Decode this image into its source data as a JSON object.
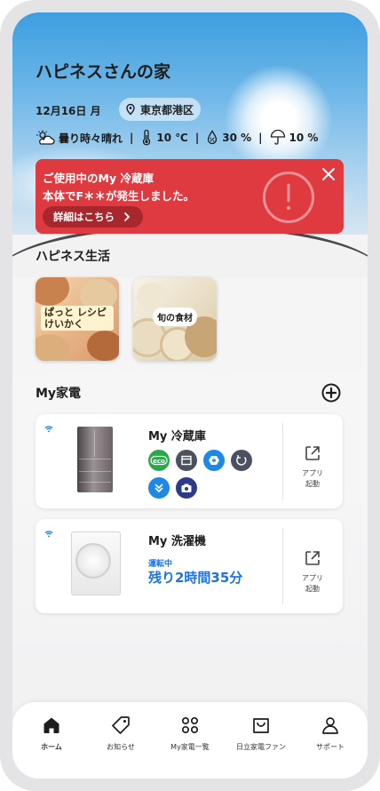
{
  "header": {
    "home_title": "ハピネスさんの家",
    "date": "12月16日 月",
    "location": "東京都港区"
  },
  "weather": {
    "condition": "曇り時々晴れ",
    "temperature": "10 ℃",
    "humidity": "30 %",
    "precipitation": "10 %"
  },
  "alert": {
    "line1": "ご使用中のMy 冷蔵庫",
    "line2": "本体でF＊＊が発生しました。",
    "details_label": "詳細はこちら"
  },
  "happiness": {
    "section_title": "ハピネス生活",
    "tiles": [
      {
        "label": "ぱっと レシピけいかく"
      },
      {
        "label": "旬の食材"
      }
    ]
  },
  "appliances": {
    "section_title": "My家電",
    "items": [
      {
        "name": "My 冷蔵庫",
        "app_label_line1": "アプリ",
        "app_label_line2": "起動"
      },
      {
        "name": "My 洗濯機",
        "status_label": "運転中",
        "status_value": "残り2時間35分",
        "app_label_line1": "アプリ",
        "app_label_line2": "起動"
      }
    ],
    "fridge_function_icons": [
      "eco-icon",
      "tray-icon",
      "snowflake-box-icon",
      "power-cycle-icon",
      "chevron-down-double-icon",
      "camera-icon"
    ]
  },
  "bottom_nav": {
    "items": [
      {
        "label": "ホーム",
        "icon": "home-icon",
        "active": true
      },
      {
        "label": "お知らせ",
        "icon": "tag-icon"
      },
      {
        "label": "My家電一覧",
        "icon": "grid-icon"
      },
      {
        "label": "日立家電ファン",
        "icon": "bag-icon"
      },
      {
        "label": "サポート",
        "icon": "person-icon"
      }
    ]
  },
  "colors": {
    "alert_red": "#df3a40",
    "accent_blue": "#1a73e8",
    "eco_green": "#2aa84a"
  }
}
